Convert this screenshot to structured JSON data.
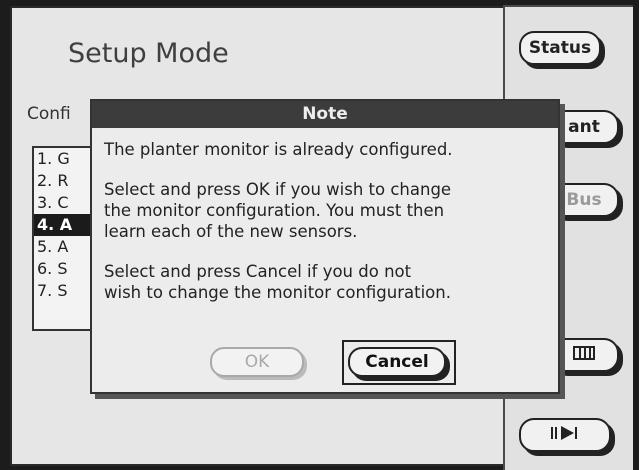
{
  "screen": {
    "title": "Setup Mode",
    "config_label": "Confi",
    "list_items": [
      {
        "label": "1. G",
        "selected": false
      },
      {
        "label": "2. R",
        "selected": false
      },
      {
        "label": "3. C",
        "selected": false
      },
      {
        "label": "4. A",
        "selected": true
      },
      {
        "label": "5. A",
        "selected": false
      },
      {
        "label": "6. S",
        "selected": false
      },
      {
        "label": "7. S",
        "selected": false
      }
    ]
  },
  "side_buttons": {
    "status": "Status",
    "plant": "ant",
    "bus": "Bus",
    "grid_icon": "grid-icon",
    "next_icon": "next-page-icon"
  },
  "dialog": {
    "title": "Note",
    "line1": "The planter monitor is already configured.",
    "para2_line1": "Select and press OK if you wish to change",
    "para2_line2": "the monitor configuration. You must then",
    "para2_line3": "learn each of the new sensors.",
    "para3_line1": "Select and press Cancel if you do not",
    "para3_line2": "wish to change the monitor configuration.",
    "ok_label": "OK",
    "cancel_label": "Cancel"
  }
}
